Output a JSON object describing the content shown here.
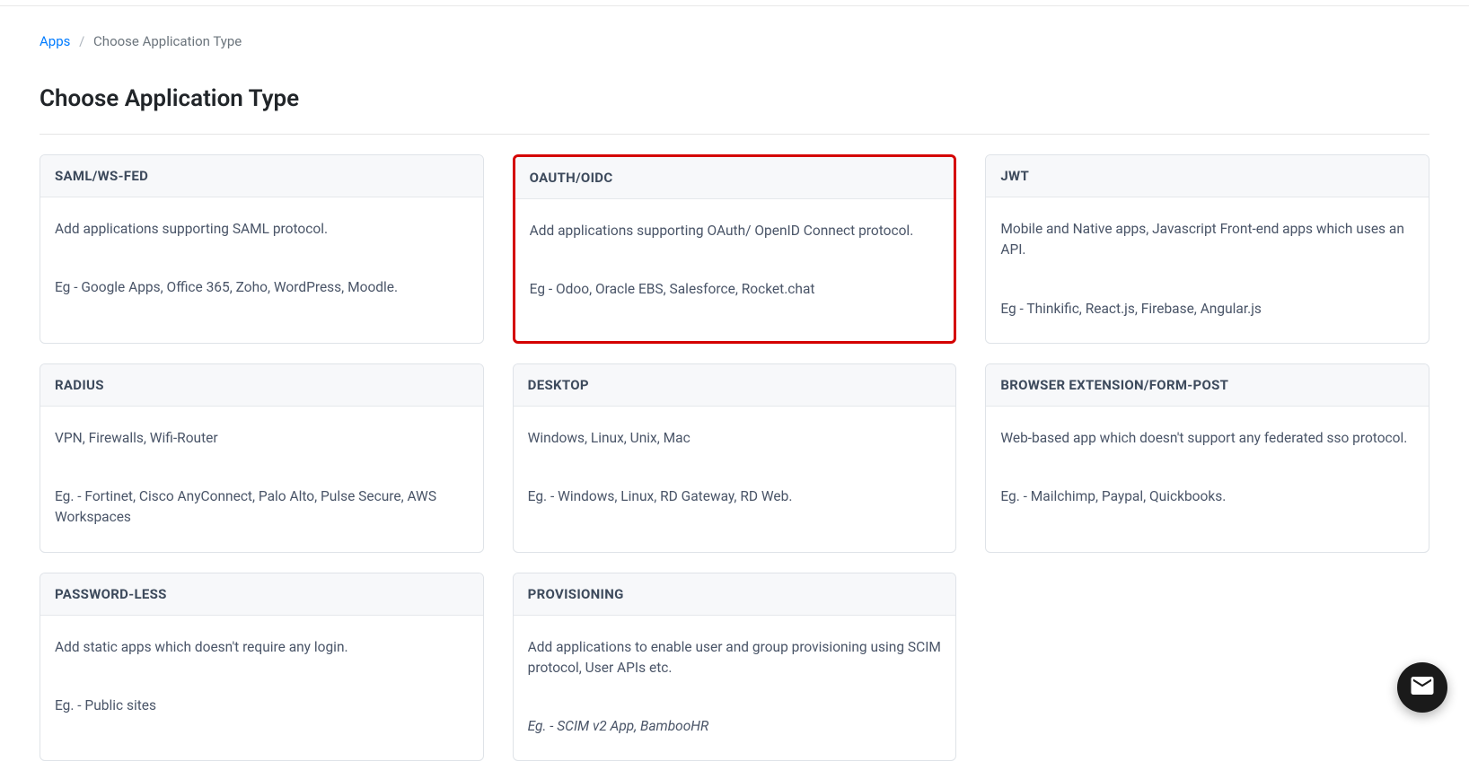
{
  "breadcrumb": {
    "root": "Apps",
    "current": "Choose Application Type"
  },
  "page_title": "Choose Application Type",
  "cards": [
    {
      "title": "SAML/WS-FED",
      "desc": "Add applications supporting SAML protocol.",
      "example": "Eg - Google Apps, Office 365, Zoho, WordPress, Moodle.",
      "highlighted": false,
      "italic_example": false
    },
    {
      "title": "OAUTH/OIDC",
      "desc": "Add applications supporting OAuth/ OpenID Connect protocol.",
      "example": "Eg - Odoo, Oracle EBS, Salesforce, Rocket.chat",
      "highlighted": true,
      "italic_example": false
    },
    {
      "title": "JWT",
      "desc": "Mobile and Native apps, Javascript Front-end apps which uses an API.",
      "example": "Eg - Thinkific, React.js, Firebase, Angular.js",
      "highlighted": false,
      "italic_example": false
    },
    {
      "title": "RADIUS",
      "desc": "VPN, Firewalls, Wifi-Router",
      "example": "Eg. - Fortinet, Cisco AnyConnect, Palo Alto, Pulse Secure, AWS Workspaces",
      "highlighted": false,
      "italic_example": false
    },
    {
      "title": "DESKTOP",
      "desc": "Windows, Linux, Unix, Mac",
      "example": "Eg. - Windows, Linux, RD Gateway, RD Web.",
      "highlighted": false,
      "italic_example": false
    },
    {
      "title": "BROWSER EXTENSION/FORM-POST",
      "desc": "Web-based app which doesn't support any federated sso protocol.",
      "example": "Eg. - Mailchimp, Paypal, Quickbooks.",
      "highlighted": false,
      "italic_example": false
    },
    {
      "title": "PASSWORD-LESS",
      "desc": "Add static apps which doesn't require any login.",
      "example": "Eg. - Public sites",
      "highlighted": false,
      "italic_example": false
    },
    {
      "title": "PROVISIONING",
      "desc": "Add applications to enable user and group provisioning using SCIM protocol, User APIs etc.",
      "example": "Eg. - SCIM v2 App, BambooHR",
      "highlighted": false,
      "italic_example": true
    }
  ]
}
